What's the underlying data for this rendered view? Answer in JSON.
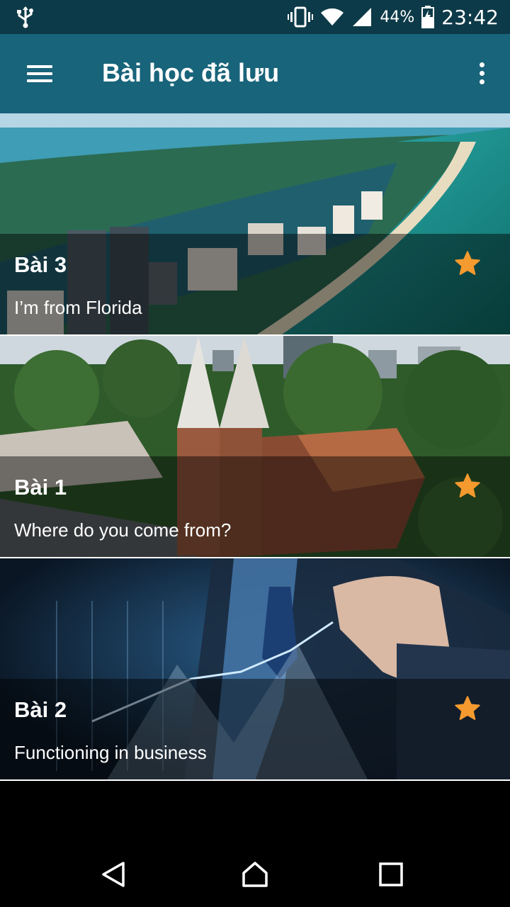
{
  "status_bar": {
    "usb_icon": "usb-icon",
    "vibrate_icon": "vibrate-icon",
    "wifi_icon": "wifi-icon",
    "signal_icon": "signal-icon",
    "battery_percent": "44%",
    "battery_icon": "battery-charging-icon",
    "time": "23:42"
  },
  "app_bar": {
    "menu_icon": "hamburger-menu-icon",
    "title": "Bài học đã lưu",
    "overflow_icon": "more-vert-icon",
    "color": "#18647a"
  },
  "lessons": [
    {
      "lesson": "Bài 3",
      "subtitle": "I’m from Florida",
      "starred": true,
      "image": "aerial-florida-coast"
    },
    {
      "lesson": "Bài 1",
      "subtitle": "Where do you come from?",
      "starred": true,
      "image": "saigon-cathedral-aerial"
    },
    {
      "lesson": "Bài 2",
      "subtitle": "Functioning in business",
      "starred": true,
      "image": "business-chart-hand"
    }
  ],
  "star_color": "#f59a2e",
  "nav_bar": {
    "back_icon": "back-triangle-icon",
    "home_icon": "home-icon",
    "recents_icon": "recents-square-icon"
  }
}
